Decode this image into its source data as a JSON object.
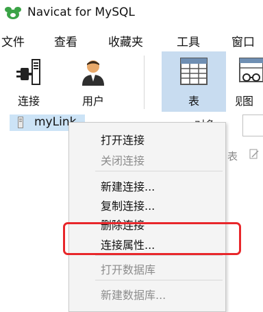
{
  "window": {
    "title": "Navicat for MySQL"
  },
  "menubar": {
    "items": [
      {
        "label": "文件"
      },
      {
        "label": "查看"
      },
      {
        "label": "收藏夹"
      },
      {
        "label": "工具"
      },
      {
        "label": "窗口"
      }
    ]
  },
  "toolbar": {
    "buttons": [
      {
        "label": "连接",
        "icon": "plug-connection-icon",
        "active": false
      },
      {
        "label": "用户",
        "icon": "user-icon",
        "active": false
      },
      {
        "label": "表",
        "icon": "table-icon",
        "active": true
      },
      {
        "label": "视图",
        "icon": "view-icon",
        "active": false
      }
    ]
  },
  "tree": {
    "connection": {
      "name": "myLink",
      "icon": "connection-icon"
    }
  },
  "object_panel": {
    "tab_label": "对象",
    "toolbar_text": "表"
  },
  "context_menu": {
    "items": [
      {
        "label": "打开连接",
        "enabled": true
      },
      {
        "label": "关闭连接",
        "enabled": false
      },
      {
        "label": "新建连接...",
        "enabled": true
      },
      {
        "label": "复制连接...",
        "enabled": true
      },
      {
        "label": "删除连接",
        "enabled": true
      },
      {
        "label": "连接属性...",
        "enabled": true,
        "highlighted": true
      },
      {
        "label": "打开数据库",
        "enabled": false
      },
      {
        "label": "新建数据库...",
        "enabled": false
      }
    ]
  },
  "colors": {
    "accent_selected": "#c8dcf0",
    "tree_selection": "#cce3f6",
    "highlight_annotation": "#e8262a",
    "logo_green": "#3aa346"
  }
}
